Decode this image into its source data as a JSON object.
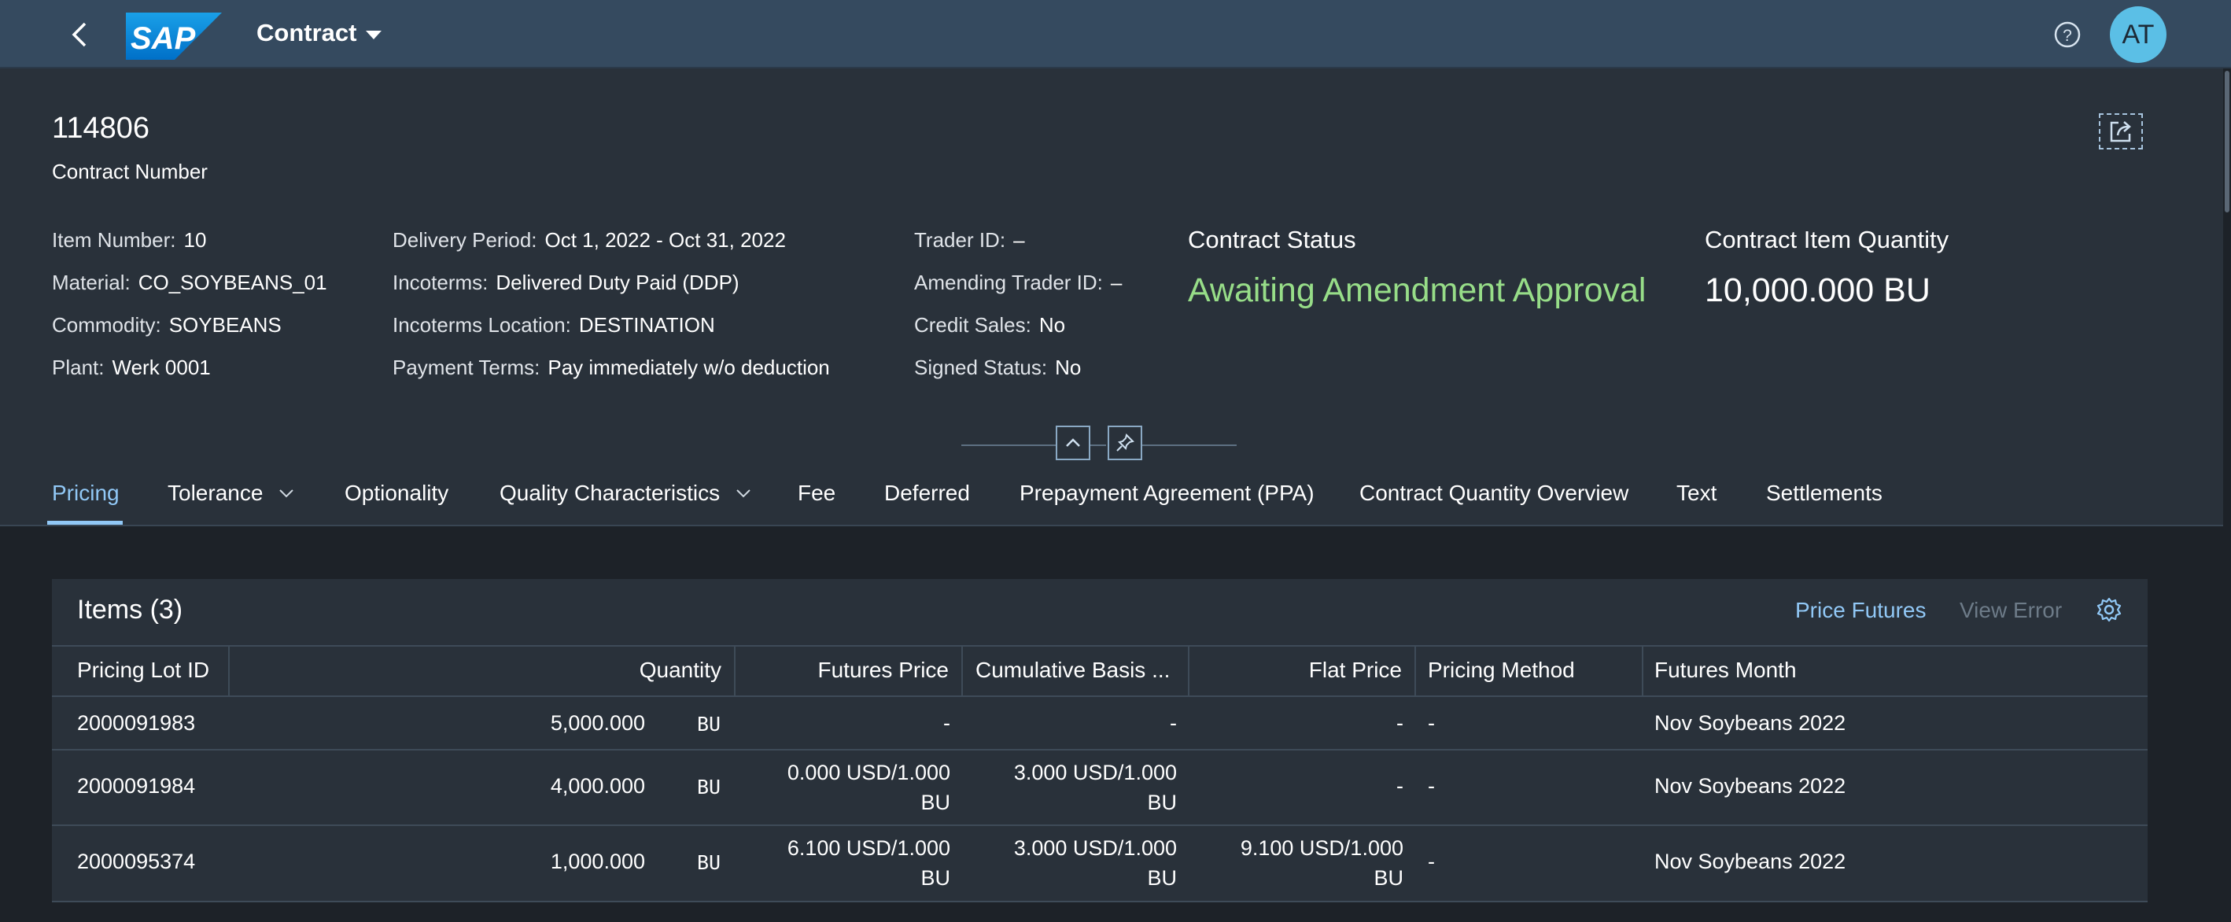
{
  "shell": {
    "app_title": "Contract",
    "logo_text": "SAP",
    "avatar_initials": "AT",
    "colors": {
      "shell_bg": "#354a5f",
      "avatar_bg": "#5bbfe6",
      "accent": "#91c8f6",
      "status_positive": "#97dd88"
    }
  },
  "header": {
    "contract_number": "114806",
    "contract_number_label": "Contract Number",
    "attributes_col1": [
      {
        "label": "Item Number:",
        "value": "10"
      },
      {
        "label": "Material:",
        "value": "CO_SOYBEANS_01"
      },
      {
        "label": "Commodity:",
        "value": "SOYBEANS"
      },
      {
        "label": "Plant:",
        "value": "Werk 0001"
      }
    ],
    "attributes_col2": [
      {
        "label": "Delivery Period:",
        "value": "Oct 1, 2022 - Oct 31, 2022"
      },
      {
        "label": "Incoterms:",
        "value": "Delivered Duty Paid (DDP)"
      },
      {
        "label": "Incoterms Location:",
        "value": "DESTINATION"
      },
      {
        "label": "Payment Terms:",
        "value": "Pay immediately w/o deduction"
      }
    ],
    "attributes_col3": [
      {
        "label": "Trader ID:",
        "value": "–"
      },
      {
        "label": "Amending Trader ID:",
        "value": "–"
      },
      {
        "label": "Credit Sales:",
        "value": "No"
      },
      {
        "label": "Signed Status:",
        "value": "No"
      }
    ],
    "status_title": "Contract Status",
    "status_value": "Awaiting Amendment Approval",
    "quantity_title": "Contract Item Quantity",
    "quantity_value": "10,000.000 BU"
  },
  "tabs": [
    {
      "label": "Pricing",
      "active": true
    },
    {
      "label": "Tolerance",
      "has_menu": true
    },
    {
      "label": "Optionality"
    },
    {
      "label": "Quality Characteristics",
      "has_menu": true
    },
    {
      "label": "Fee"
    },
    {
      "label": "Deferred"
    },
    {
      "label": "Prepayment Agreement (PPA)"
    },
    {
      "label": "Contract Quantity Overview"
    },
    {
      "label": "Text"
    },
    {
      "label": "Settlements"
    }
  ],
  "items_table": {
    "title": "Items (3)",
    "actions": {
      "price_futures": "Price Futures",
      "view_error": "View Error"
    },
    "columns": [
      "Pricing Lot ID",
      "Quantity",
      "Futures Price",
      "Cumulative Basis ...",
      "Flat Price",
      "Pricing Method",
      "Futures Month"
    ],
    "rows": [
      {
        "lot_id": "2000091983",
        "quantity": "5,000.000",
        "unit": "BU",
        "futures_price": "-",
        "futures_price_unit": "",
        "cum_basis": "-",
        "cum_basis_unit": "",
        "flat_price": "-",
        "flat_price_unit": "",
        "pricing_method": "-",
        "futures_month": "Nov Soybeans 2022"
      },
      {
        "lot_id": "2000091984",
        "quantity": "4,000.000",
        "unit": "BU",
        "futures_price": "0.000 USD/1.000",
        "futures_price_unit": "BU",
        "cum_basis": "3.000 USD/1.000",
        "cum_basis_unit": "BU",
        "flat_price": "-",
        "flat_price_unit": "",
        "pricing_method": "-",
        "futures_month": "Nov Soybeans 2022"
      },
      {
        "lot_id": "2000095374",
        "quantity": "1,000.000",
        "unit": "BU",
        "futures_price": "6.100 USD/1.000",
        "futures_price_unit": "BU",
        "cum_basis": "3.000 USD/1.000",
        "cum_basis_unit": "BU",
        "flat_price": "9.100 USD/1.000",
        "flat_price_unit": "BU",
        "pricing_method": "-",
        "futures_month": "Nov Soybeans 2022"
      }
    ]
  }
}
